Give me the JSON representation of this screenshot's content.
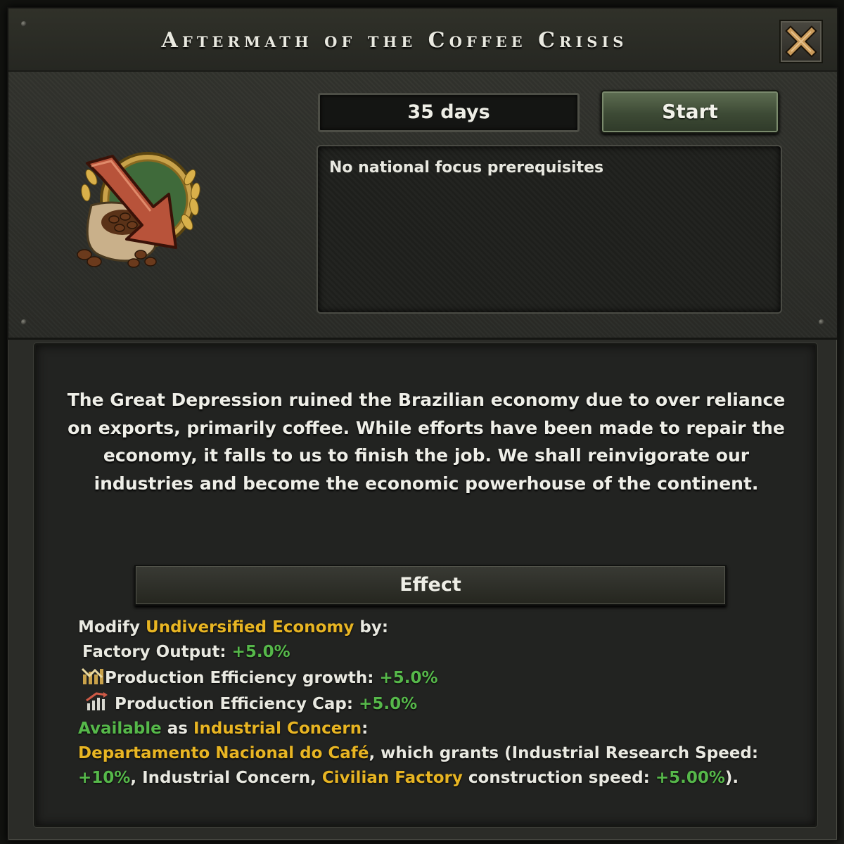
{
  "window": {
    "title": "Aftermath of the Coffee Crisis",
    "close_icon": "close-x-icon"
  },
  "focus": {
    "duration": "35 days",
    "start_label": "Start",
    "prerequisites_text": "No national focus prerequisites",
    "icon": "coffee-sack-downward-arrow-icon"
  },
  "description": "The Great Depression ruined the Brazilian economy due to over reliance on exports, primarily coffee. While efforts have been made to repair the economy, it falls to us to finish the job. We shall reinvigorate our industries and become the economic powerhouse of the continent.",
  "effect": {
    "header": "Effect",
    "modify_prefix": "Modify ",
    "modify_target": "Undiversified Economy",
    "modify_suffix": " by:",
    "factory_output_label": "Factory Output: ",
    "factory_output_value": "+5.0%",
    "prod_eff_growth_label": "Production Efficiency growth: ",
    "prod_eff_growth_value": "+5.0%",
    "prod_eff_cap_label": "Production Efficiency Cap: ",
    "prod_eff_cap_value": "+5.0%",
    "available": "Available",
    "as_text": " as ",
    "concern_type": "Industrial Concern",
    "colon": ":",
    "concern_name": "Departamento Nacional do Café",
    "grants_text": ", which grants (Industrial Research Speed:",
    "research_value": "+10%",
    "concern_text": ", Industrial Concern, ",
    "civ_factory": "Civilian Factory",
    "construction_text": " construction speed: ",
    "construction_value": "+5.00%",
    "closing": ")."
  },
  "colors": {
    "highlight_yellow": "#e8b523",
    "positive_green": "#56b84a",
    "start_button_green": "#4a5a40"
  }
}
